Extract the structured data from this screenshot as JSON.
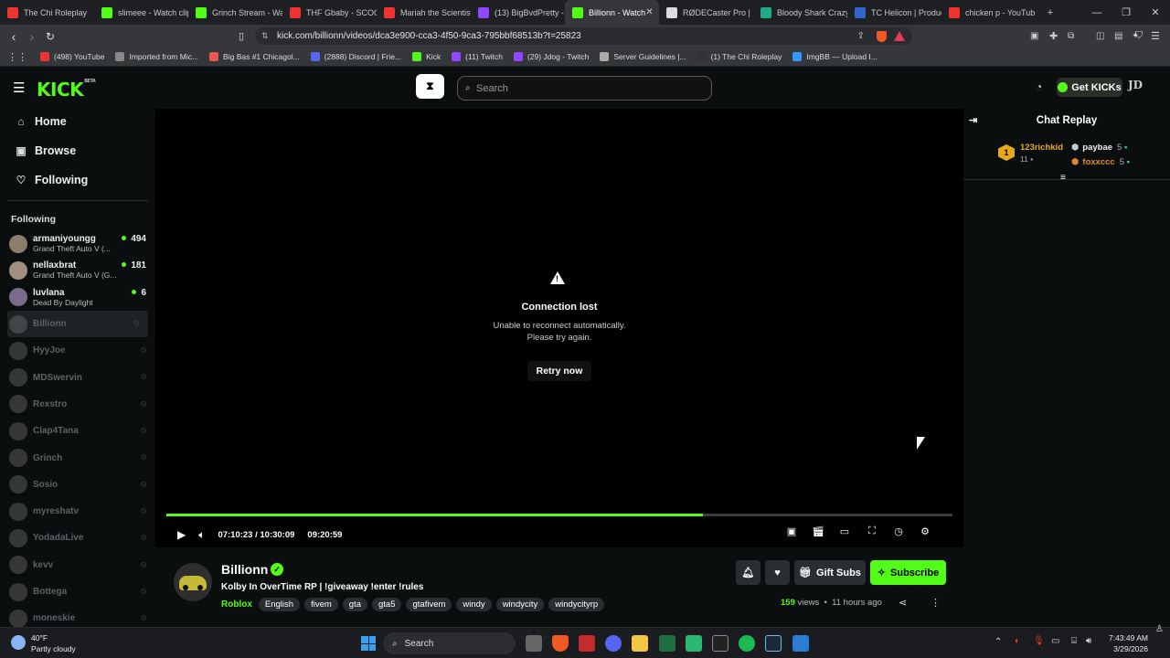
{
  "browser": {
    "tabs": [
      {
        "title": "The Chi Roleplay",
        "color": "#e33"
      },
      {
        "title": "slimeee - Watch clip",
        "color": "#53fc18"
      },
      {
        "title": "Grinch Stream - Wa",
        "color": "#53fc18"
      },
      {
        "title": "THF Gbaby - SCOO",
        "color": "#e33"
      },
      {
        "title": "Mariah the Scientist",
        "color": "#e33"
      },
      {
        "title": "(13) BigBvdPretty -",
        "color": "#9146ff"
      },
      {
        "title": "Billionn - Watch",
        "color": "#53fc18",
        "active": true
      },
      {
        "title": "RØDECaster Pro | Po",
        "color": "#ddd"
      },
      {
        "title": "Bloody Shark Crazy",
        "color": "#2a8"
      },
      {
        "title": "TC Helicon | Produc",
        "color": "#36c"
      },
      {
        "title": "chicken p - YouTub",
        "color": "#e33"
      }
    ],
    "url": "kick.com/billionn/videos/dca3e900-cca3-4f50-9ca3-795bbf68513b?t=25823",
    "bookmarks": [
      {
        "label": "(498) YouTube",
        "color": "#e33"
      },
      {
        "label": "Imported from Mic...",
        "color": "#888"
      },
      {
        "label": "Big Bas #1 Chicagol...",
        "color": "#e55"
      },
      {
        "label": "(2888) Discord | Frie...",
        "color": "#5865f2"
      },
      {
        "label": "Kick",
        "color": "#53fc18"
      },
      {
        "label": "(11) Twitch",
        "color": "#9146ff"
      },
      {
        "label": "(29) Jdog - Twitch",
        "color": "#9146ff"
      },
      {
        "label": "Server Guidelines |...",
        "color": "#aaa"
      },
      {
        "label": "(1) The Chi Roleplay",
        "color": "#333"
      },
      {
        "label": "ImgBB — Upload I...",
        "color": "#39f"
      }
    ]
  },
  "header": {
    "logo": "KICK",
    "logo_badge": "BETA",
    "search_placeholder": "Search",
    "get_kicks": "Get KICKs"
  },
  "sidebar": {
    "nav": [
      {
        "label": "Home",
        "icon": "home-icon"
      },
      {
        "label": "Browse",
        "icon": "browse-icon"
      },
      {
        "label": "Following",
        "icon": "heart-icon"
      }
    ],
    "following_title": "Following",
    "live": [
      {
        "name": "armaniyoungg",
        "game": "Grand Theft Auto V (...",
        "viewers": "494"
      },
      {
        "name": "nellaxbrat",
        "game": "Grand Theft Auto V (G...",
        "viewers": "181"
      },
      {
        "name": "luvlana",
        "game": "Dead By Daylight",
        "viewers": "6"
      }
    ],
    "offline": [
      "Billionn",
      "HyyJoe",
      "MDSwervin",
      "Rexstro",
      "Clap4Tana",
      "Grinch",
      "Sosio",
      "myreshatv",
      "YodadaLive",
      "kevv",
      "Bottega",
      "moneskie"
    ]
  },
  "player": {
    "error_title": "Connection lost",
    "error_line1": "Unable to reconnect automatically.",
    "error_line2": "Please try again.",
    "retry_label": "Retry now",
    "time_current": "07:10:23",
    "time_sep": "/",
    "time_total": "10:30:09",
    "time_remaining": "09:20:59",
    "progress_percent": 68.3
  },
  "chat": {
    "title": "Chat Replay",
    "top_rank": "1",
    "top_user": "123richkid",
    "top_count": "11",
    "gifters": [
      {
        "name": "paybae",
        "count": "5"
      },
      {
        "name": "foxxccc",
        "count": "5"
      }
    ]
  },
  "channel": {
    "name": "Billionn",
    "title": "Kolby In OverTime RP | !giveaway !enter !rules",
    "category": "Roblox",
    "tags": [
      "English",
      "fivem",
      "gta",
      "gta5",
      "gtafivem",
      "windy",
      "windycity",
      "windycityrp"
    ],
    "views": "159",
    "views_label": "views",
    "age": "11 hours ago",
    "gift_subs": "Gift Subs",
    "subscribe": "Subscribe"
  },
  "taskbar": {
    "temp": "40°F",
    "weather": "Partly cloudy",
    "search": "Search",
    "time": "7:43:49 AM",
    "date": "3/29/2026"
  }
}
